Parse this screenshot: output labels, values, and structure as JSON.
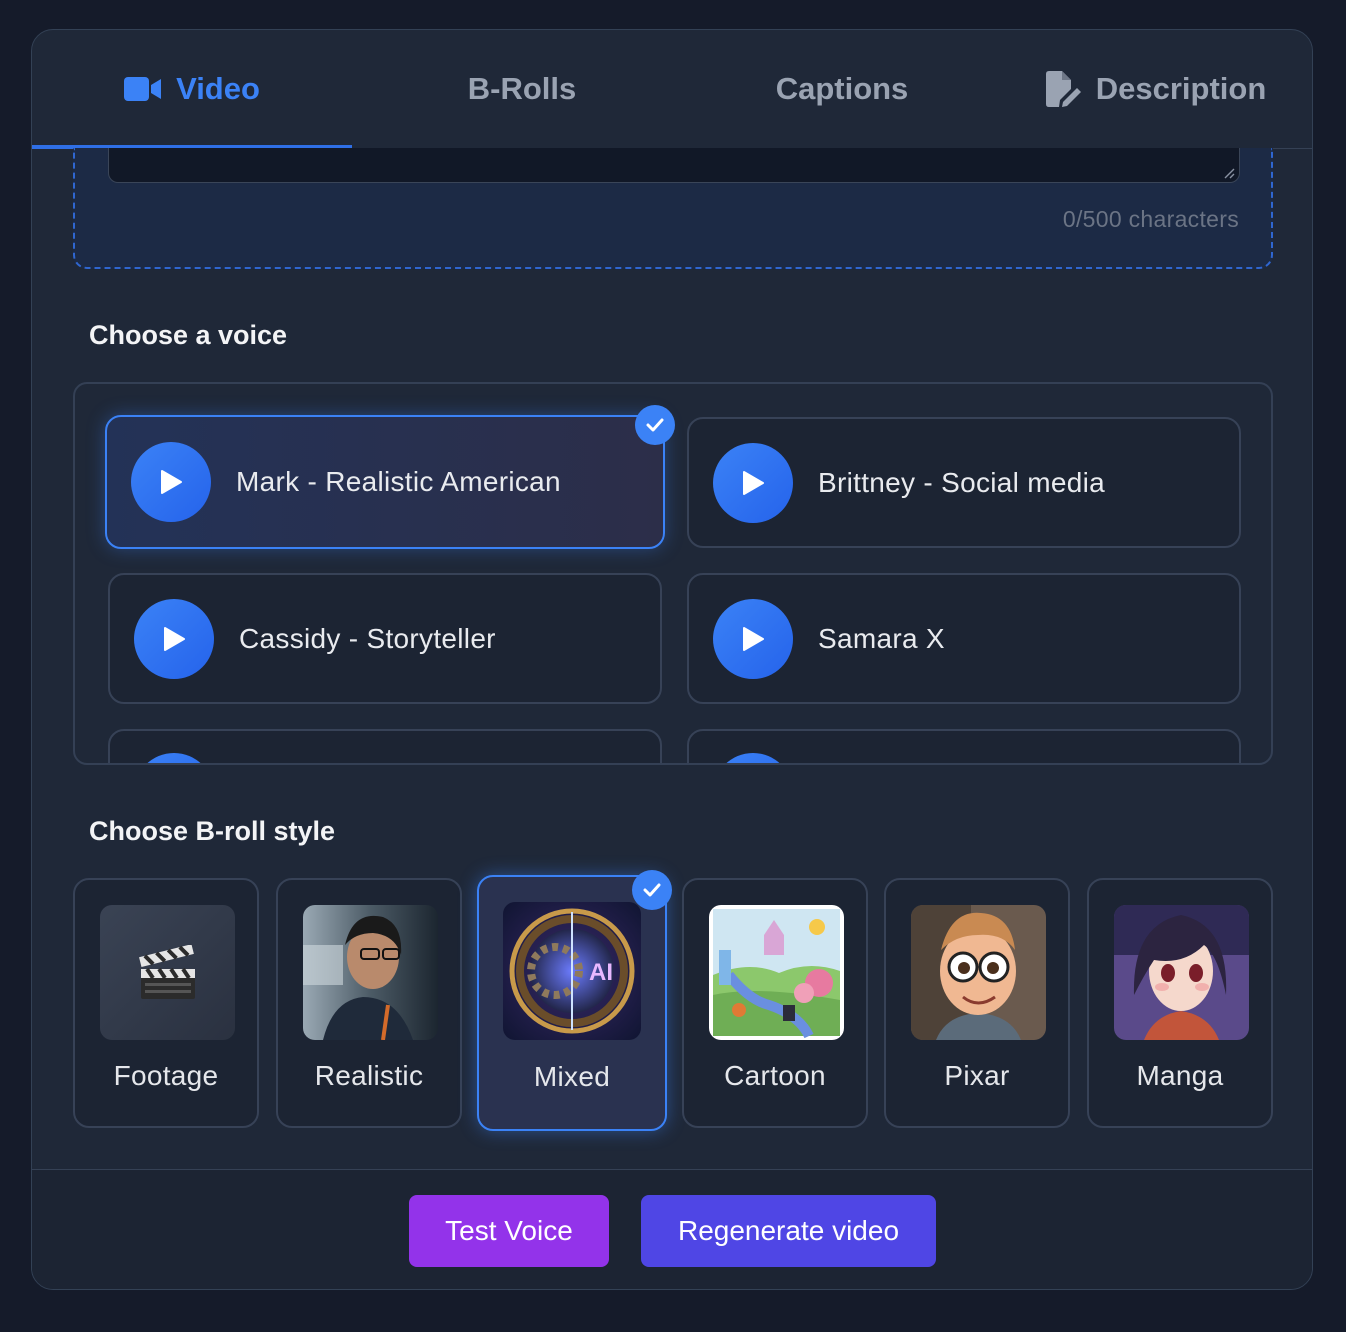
{
  "tabs": [
    {
      "label": "Video",
      "icon": "video-camera-icon",
      "active": true
    },
    {
      "label": "B-Rolls",
      "icon": "",
      "active": false
    },
    {
      "label": "Captions",
      "icon": "",
      "active": false
    },
    {
      "label": "Description",
      "icon": "file-edit-icon",
      "active": false
    }
  ],
  "prompt": {
    "char_count": "0/500 characters"
  },
  "voice_section": {
    "heading": "Choose a voice",
    "voices": [
      {
        "name": "Mark - Realistic American",
        "selected": true
      },
      {
        "name": "Brittney - Social media",
        "selected": false
      },
      {
        "name": "Cassidy - Storyteller",
        "selected": false
      },
      {
        "name": "Samara X",
        "selected": false
      }
    ]
  },
  "broll_section": {
    "heading": "Choose B-roll style",
    "styles": [
      {
        "label": "Footage",
        "icon": "clapperboard-icon",
        "selected": false
      },
      {
        "label": "Realistic",
        "icon": "realistic-portrait-thumbnail",
        "selected": false
      },
      {
        "label": "Mixed",
        "icon": "ai-mixed-thumbnail",
        "selected": true
      },
      {
        "label": "Cartoon",
        "icon": "cartoon-landscape-thumbnail",
        "selected": false
      },
      {
        "label": "Pixar",
        "icon": "pixar-character-thumbnail",
        "selected": false
      },
      {
        "label": "Manga",
        "icon": "manga-girl-thumbnail",
        "selected": false
      }
    ]
  },
  "footer": {
    "test_voice_label": "Test Voice",
    "regenerate_label": "Regenerate video"
  },
  "colors": {
    "accent": "#3b82f6",
    "test_voice_button": "#9333ea",
    "regenerate_button": "#4f46e5"
  }
}
